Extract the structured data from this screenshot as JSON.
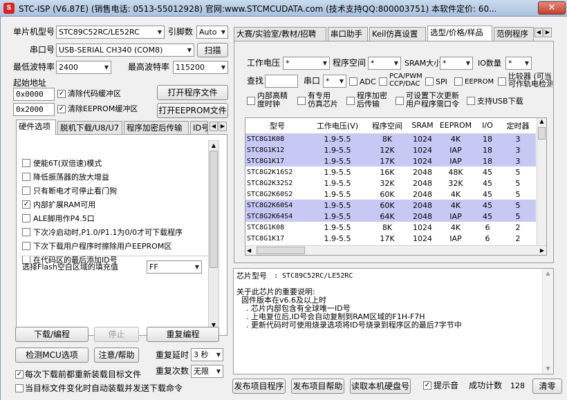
{
  "title": "STC-ISP (V6.87E) (销售电话: 0513-55012928) 官网:www.STCMCUDATA.com  (技术支持QQ:800003751) 本软件定价: 60...",
  "colors": {
    "selected_row": "#c7c8f4",
    "title_bar": "#b6cbe4"
  },
  "left": {
    "mcu_type_label": "单片机型号",
    "mcu_type_value": "STC89C52RC/LE52RC",
    "pins_label": "引脚数",
    "pins_value": "Auto",
    "port_label": "串口号",
    "port_value": "USB-SERIAL CH340 (COM8)",
    "scan_button": "扫描",
    "min_baud_label": "最低波特率",
    "min_baud_value": "2400",
    "max_baud_label": "最高波特率",
    "max_baud_value": "115200",
    "start_addr_label": "起始地址",
    "addr1": "0x0000",
    "clear_code_label": "清除代码缓冲区",
    "open_program_button": "打开程序文件",
    "addr2": "0x2000",
    "clear_eeprom_label": "清除EEPROM缓冲区",
    "open_eeprom_button": "打开EEPROM文件",
    "tabs": [
      "硬件选项",
      "脱机下载/U8/U7",
      "程序加密后传输",
      "ID号"
    ],
    "options": [
      {
        "label": "使能6T(双倍速)模式",
        "checked": false
      },
      {
        "label": "降低振荡器的放大增益",
        "checked": false
      },
      {
        "label": "只有断电才可停止看门狗",
        "checked": false
      },
      {
        "label": "内部扩展RAM可用",
        "checked": true
      },
      {
        "label": "ALE脚用作P4.5口",
        "checked": false
      },
      {
        "label": "下次冷启动时,P1.0/P1.1为0/0才可下载程序",
        "checked": false
      },
      {
        "label": "下次下载用户程序时擦除用户EEPROM区",
        "checked": false
      },
      {
        "label": "在代码区的最后添加ID号",
        "checked": false
      }
    ],
    "flash_fill_label": "选择Flash空白区域的填充值",
    "flash_fill_value": "FF",
    "download_button": "下载/编程",
    "stop_button": "停止",
    "reprogram_button": "重复编程",
    "detect_button": "检测MCU选项",
    "help_button": "注意/帮助",
    "repeat_delay_label": "重复延时",
    "repeat_delay_value": "3 秒",
    "repeat_count_label": "重复次数",
    "repeat_count_value": "无限",
    "reload_label": "每次下载前都重新装载目标文件",
    "reload_checked": true,
    "auto_load_label": "当目标文件变化时自动装载并发送下载命令",
    "auto_load_checked": false
  },
  "right": {
    "tabs": [
      "大赛/实验室/教材/招聘",
      "串口助手",
      "Keil仿真设置",
      "选型/价格/样品",
      "范例程序"
    ],
    "filter": {
      "voltage_label": "工作电压",
      "voltage_value": "*",
      "prog_space_label": "程序空间",
      "prog_space_value": "*",
      "sram_label": "SRAM大小",
      "sram_value": "*",
      "io_label": "IO数量",
      "io_value": "*",
      "find_label": "查找",
      "uart_label": "串口",
      "uart_value": "*",
      "adc": "ADC",
      "pca": "PCA/PWM\nCCP/DAC",
      "spi": "SPI",
      "eeprom": "EEPROM",
      "comparator": "比较器 (可当\n可作轨电检测",
      "internal_clock": "内部高精\n度时钟",
      "emulation": "有专用\n仿真芯片",
      "encrypt": "程序加密\n后传输",
      "user_cmd": "可设置下次更新\n用户程序需口令",
      "usb": "支持USB下载"
    },
    "columns": [
      "型号",
      "工作电压(V)",
      "程序空间",
      "SRAM",
      "EEPROM",
      "I/O",
      "定时器"
    ],
    "rows": [
      {
        "model": "STC8G1K08",
        "voltage": "1.9-5.5",
        "flash": "8K",
        "sram": "1024",
        "eeprom": "4K",
        "io": "18",
        "timers": "3",
        "selected": true
      },
      {
        "model": "STC8G1K12",
        "voltage": "1.9-5.5",
        "flash": "12K",
        "sram": "1024",
        "eeprom": "IAP",
        "io": "18",
        "timers": "3",
        "selected": true
      },
      {
        "model": "STC8G1K17",
        "voltage": "1.9-5.5",
        "flash": "17K",
        "sram": "1024",
        "eeprom": "IAP",
        "io": "18",
        "timers": "3",
        "selected": true
      },
      {
        "model": "STC8G2K16S2",
        "voltage": "1.9-5.5",
        "flash": "16K",
        "sram": "2048",
        "eeprom": "48K",
        "io": "45",
        "timers": "5",
        "selected": false
      },
      {
        "model": "STC8G2K32S2",
        "voltage": "1.9-5.5",
        "flash": "32K",
        "sram": "2048",
        "eeprom": "32K",
        "io": "45",
        "timers": "5",
        "selected": false
      },
      {
        "model": "STC8G2K60S2",
        "voltage": "1.9-5.5",
        "flash": "60K",
        "sram": "2048",
        "eeprom": "4K",
        "io": "45",
        "timers": "5",
        "selected": false
      },
      {
        "model": "STC8G2K60S4",
        "voltage": "1.9-5.5",
        "flash": "60K",
        "sram": "2048",
        "eeprom": "4K",
        "io": "45",
        "timers": "5",
        "selected": true
      },
      {
        "model": "STC8G2K64S4",
        "voltage": "1.9-5.5",
        "flash": "64K",
        "sram": "2048",
        "eeprom": "IAP",
        "io": "45",
        "timers": "5",
        "selected": true
      },
      {
        "model": "STC8G1K08",
        "voltage": "1.9-5.5",
        "flash": "8K",
        "sram": "1024",
        "eeprom": "4K",
        "io": "6",
        "timers": "2",
        "selected": false
      },
      {
        "model": "STC8G1K17",
        "voltage": "1.9-5.5",
        "flash": "17K",
        "sram": "1024",
        "eeprom": "IAP",
        "io": "6",
        "timers": "2",
        "selected": false
      }
    ],
    "info_chip_label": "芯片型号",
    "info_chip_value": ": STC89C52RC/LE52RC",
    "info_lines": [
      "关于此芯片的重要说明:",
      "  固件版本在v6.6及以上时",
      "    . 芯片内部包含有全球唯一ID号",
      "    . 上电复位后,ID号会自动复制到RAM区域的F1H-F7H",
      "    . 更新代码时可使用烧录选项将ID号烧录到程序区的最后7字节中"
    ],
    "publish_button": "发布项目程序",
    "publish_help_button": "发布项目帮助",
    "read_disk_button": "读取本机硬盘号",
    "sound_label": "提示音",
    "sound_checked": true,
    "success_count_label": "成功计数",
    "success_count_value": "128",
    "clear_button": "清零"
  }
}
